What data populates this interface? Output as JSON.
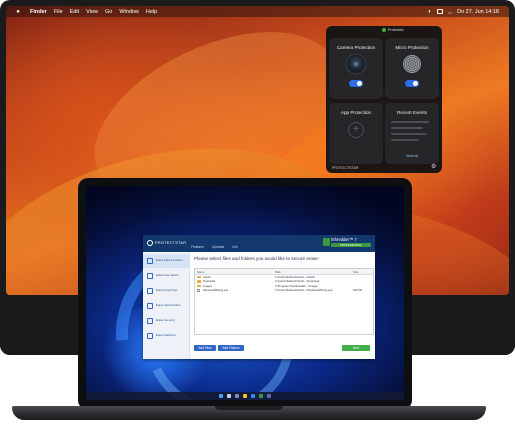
{
  "menubar": {
    "apple_icon": "apple-icon",
    "app_name": "Finder",
    "items": [
      "File",
      "Edit",
      "View",
      "Go",
      "Window",
      "Help"
    ],
    "clock": "Do 27. Jun  14:18"
  },
  "widget": {
    "status_label": "Protected",
    "status_badge": "",
    "cards": [
      {
        "title": "Camera Protection",
        "kind": "camera",
        "toggle_on": true
      },
      {
        "title": "Micro Protection",
        "kind": "microphone",
        "toggle_on": true
      },
      {
        "title": "App Protection",
        "kind": "add"
      },
      {
        "title": "Recent Events",
        "kind": "events",
        "link": "View all"
      }
    ],
    "footer_brand": "PROTECTSTAR"
  },
  "app": {
    "logo": "PROTECTSTAR",
    "nav": [
      "Features",
      "Updates",
      "Info"
    ],
    "brand_name": "iShredder™ 7",
    "brand_edition": "PROFESSIONAL",
    "sidebar": [
      "Erase Files & Folders",
      "Erase Free Space",
      "Erase Temp Files",
      "Erase Internet Files",
      "Erase Securely",
      "Erase Partitions"
    ],
    "instruction": "Please select files and folders you would like to secure erase:",
    "table": {
      "columns": [
        "Name",
        "Path",
        "Size"
      ],
      "rows": [
        {
          "type": "folder",
          "name": "Cache",
          "path": "C:\\Users\\TelebuchVoice\\...\\Cache",
          "size": ""
        },
        {
          "type": "folder",
          "name": "Download",
          "path": "C:\\Users\\TelebuchVoice\\...\\Download",
          "size": ""
        },
        {
          "type": "folder",
          "name": "images",
          "path": "C:\\Program Files\\Installer\\...\\images",
          "size": ""
        },
        {
          "type": "file",
          "name": "PasswordWiping.exe",
          "path": "C:\\Users\\TelebuchVoice\\...\\PasswordWiping.exe",
          "size": "506 KB"
        }
      ]
    },
    "buttons": {
      "add_files": "Add Files",
      "add_folders": "Add Folders",
      "next": "Next"
    }
  }
}
